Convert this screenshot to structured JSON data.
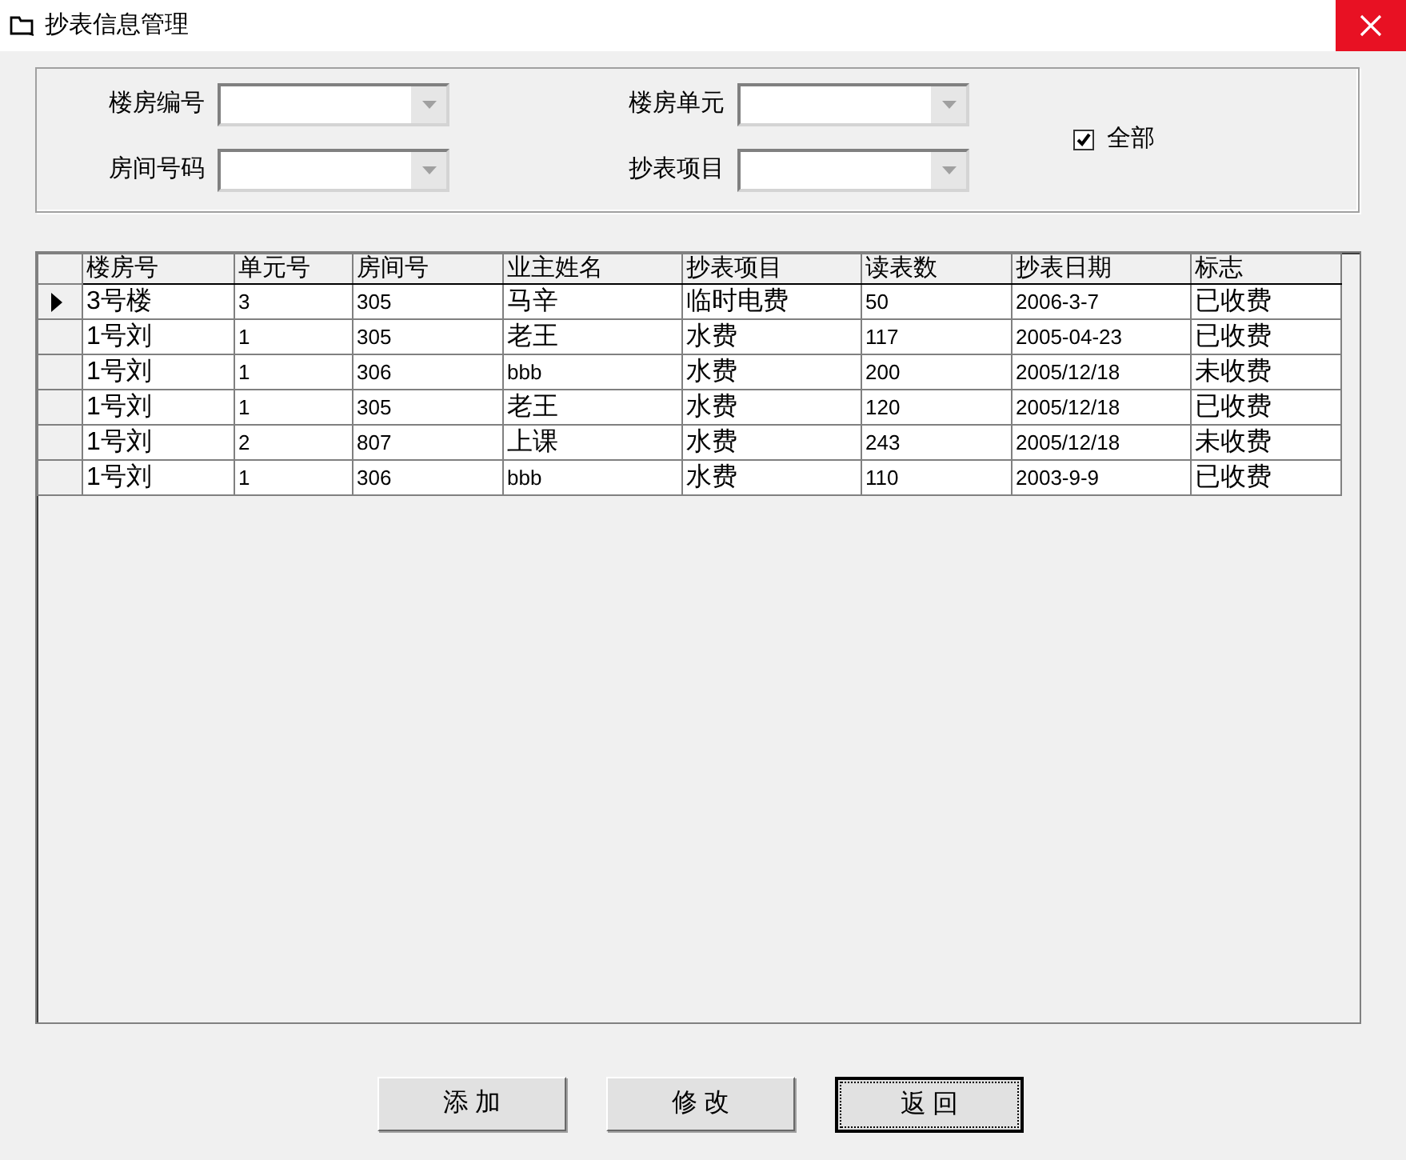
{
  "window": {
    "title": "抄表信息管理"
  },
  "filters": [
    {
      "label": "楼房编号"
    },
    {
      "label": "楼房单元"
    },
    {
      "label": "房间号码"
    },
    {
      "label": "抄表项目"
    }
  ],
  "all_checkbox": {
    "label": "全部",
    "checked": true
  },
  "table": {
    "columns": [
      "楼房号",
      "单元号",
      "房间号",
      "业主姓名",
      "抄表项目",
      "读表数",
      "抄表日期",
      "标志"
    ],
    "rows": [
      {
        "current": true,
        "cells": [
          "3号楼",
          "3",
          "305",
          "马辛",
          "临时电费",
          "50",
          "2006-3-7",
          "已收费"
        ]
      },
      {
        "current": false,
        "cells": [
          "1号刘",
          "1",
          "305",
          "老王",
          "水费",
          "117",
          "2005-04-23",
          "已收费"
        ]
      },
      {
        "current": false,
        "cells": [
          "1号刘",
          "1",
          "306",
          "bbb",
          "水费",
          "200",
          "2005/12/18",
          "未收费"
        ]
      },
      {
        "current": false,
        "cells": [
          "1号刘",
          "1",
          "305",
          "老王",
          "水费",
          "120",
          "2005/12/18",
          "已收费"
        ]
      },
      {
        "current": false,
        "cells": [
          "1号刘",
          "2",
          "807",
          "上课",
          "水费",
          "243",
          "2005/12/18",
          "未收费"
        ]
      },
      {
        "current": false,
        "cells": [
          "1号刘",
          "1",
          "306",
          "bbb",
          "水费",
          "110",
          "2003-9-9",
          "已收费"
        ]
      }
    ]
  },
  "buttons": [
    {
      "label": "添 加",
      "focused": false
    },
    {
      "label": "修 改",
      "focused": false
    },
    {
      "label": "返 回",
      "focused": true
    }
  ]
}
